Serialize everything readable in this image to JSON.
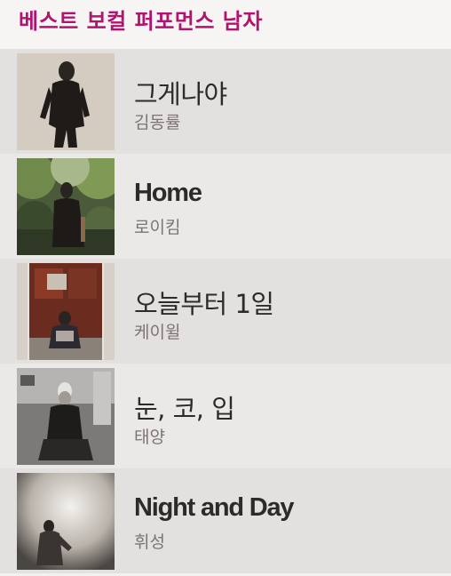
{
  "header": {
    "title": "베스트 보컬 퍼포먼스 남자",
    "title_color": "#b0146e"
  },
  "nominees": [
    {
      "title": "그게나야",
      "artist": "김동률",
      "thumb_icon": "album-photo"
    },
    {
      "title": "Home",
      "artist": "로이킴",
      "thumb_icon": "album-photo"
    },
    {
      "title": "오늘부터 1일",
      "artist": "케이윌",
      "thumb_icon": "album-photo"
    },
    {
      "title": "눈, 코, 입",
      "artist": "태양",
      "thumb_icon": "album-photo"
    },
    {
      "title": "Night and Day",
      "artist": "휘성",
      "thumb_icon": "album-photo"
    }
  ]
}
